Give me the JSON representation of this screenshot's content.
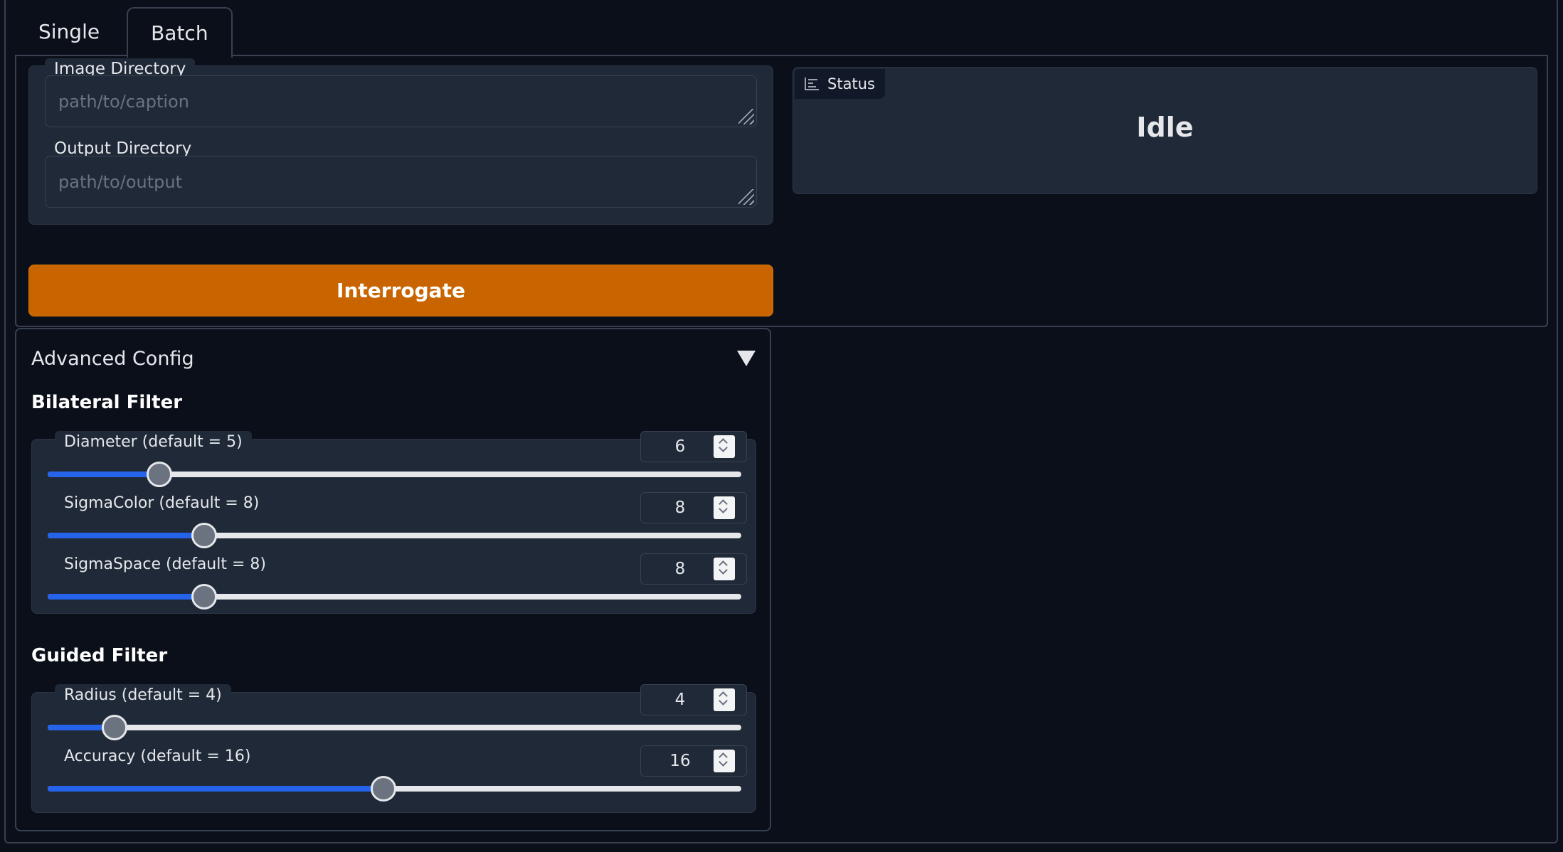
{
  "tabs": [
    {
      "label": "Single",
      "selected": false
    },
    {
      "label": "Batch",
      "selected": true
    }
  ],
  "batch": {
    "image_directory": {
      "label": "Image Directory",
      "value": "",
      "placeholder": "path/to/caption"
    },
    "output_directory": {
      "label": "Output Directory",
      "value": "",
      "placeholder": "path/to/output"
    },
    "interrogate_label": "Interrogate"
  },
  "status": {
    "label": "Status",
    "icon": "bar-chart-icon",
    "value": "Idle"
  },
  "advanced_config": {
    "title": "Advanced Config",
    "expanded": true,
    "bilateral_filter": {
      "heading": "Bilateral Filter",
      "sliders": [
        {
          "label": "Diameter (default = 5)",
          "value": "6",
          "min": 1,
          "max": 32
        },
        {
          "label": "SigmaColor (default = 8)",
          "value": "8",
          "min": 1,
          "max": 32
        },
        {
          "label": "SigmaSpace (default = 8)",
          "value": "8",
          "min": 1,
          "max": 32
        }
      ]
    },
    "guided_filter": {
      "heading": "Guided Filter",
      "sliders": [
        {
          "label": "Radius (default = 4)",
          "value": "4",
          "min": 1,
          "max": 32
        },
        {
          "label": "Accuracy (default = 16)",
          "value": "16",
          "min": 1,
          "max": 32
        }
      ]
    }
  },
  "colors": {
    "background": "#0b0f19",
    "panel": "#1f2937",
    "accent": "#c96500",
    "slider_fill": "#2563eb"
  }
}
